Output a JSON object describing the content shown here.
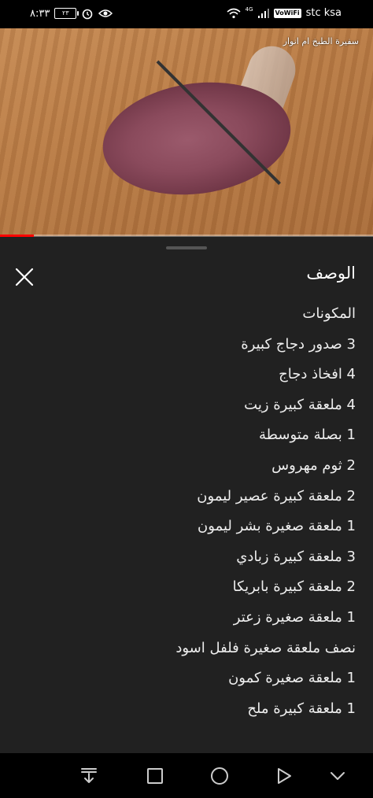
{
  "status_bar": {
    "time": "٨:٣٣",
    "battery": "٢٣",
    "carrier": "stc ksa",
    "vowifi": "VoWiFi",
    "signal_label": "4G"
  },
  "video": {
    "watermark": "سفيرة الطبخ ام انوار",
    "progress": 0.09,
    "accent_color": "#ff0000"
  },
  "panel": {
    "title": "الوصف",
    "close_icon": "close-icon",
    "description_lines": [
      "المكونات",
      "3 صدور دجاج كبيرة",
      "4 افخاذ دجاج",
      "4 ملعقة كبيرة زيت",
      "1 بصلة متوسطة",
      "2 ثوم مهروس",
      "2 ملعقة كبيرة عصير ليمون",
      "1 ملعقة صغيرة بشر ليمون",
      "3 ملعقة كبيرة زبادي",
      "2 ملعقة كبيرة بابريكا",
      "1 ملعقة صغيرة زعتر",
      "نصف ملعقة صغيرة فلفل اسود",
      "1 ملعقة صغيرة كمون",
      "1 ملعقة كبيرة ملح"
    ]
  },
  "nav_bar": {
    "icons": [
      "download-icon",
      "square-icon",
      "circle-icon",
      "triangle-icon",
      "chevron-down-icon"
    ]
  }
}
